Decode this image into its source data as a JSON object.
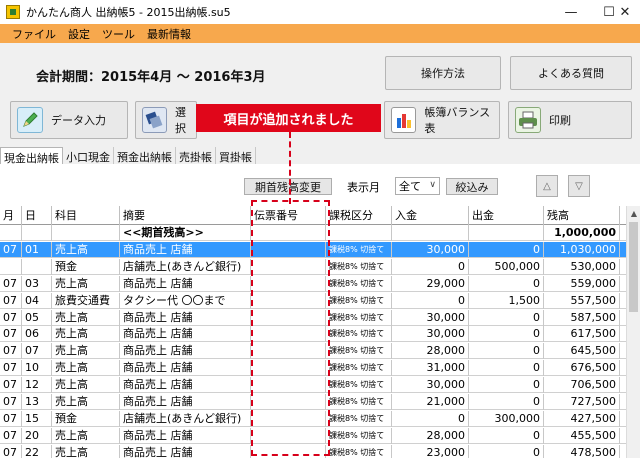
{
  "window": {
    "title": "かんたん商人 出納帳5 - 2015出納帳.su5",
    "minimize": "—",
    "maximize": "☐",
    "close": "✕"
  },
  "menu": [
    "ファイル",
    "設定",
    "ツール",
    "最新情報"
  ],
  "header": {
    "period": "会計期間：2015年4月 〜 2016年3月",
    "buttons": {
      "manual": "操作方法",
      "faq": "よくある質問",
      "data_entry": "データ入力",
      "select": "選択",
      "balance": "帳簿バランス表",
      "print": "印刷"
    }
  },
  "callout": "項目が追加されました",
  "tabs": [
    "現金出納帳",
    "小口現金",
    "預金出納帳",
    "売掛帳",
    "買掛帳"
  ],
  "filter": {
    "opening_balance_btn": "期首残高変更",
    "month_label": "表示月",
    "month_value": "全て",
    "filter_btn": "絞込み",
    "up": "△",
    "down": "▽"
  },
  "table": {
    "headers": [
      "月",
      "日",
      "科目",
      "摘要",
      "伝票番号",
      "課税区分",
      "入金",
      "出金",
      "残高"
    ],
    "rows": [
      {
        "m": "",
        "d": "",
        "kamoku": "",
        "tekiyo": "<<期首残高>>",
        "den": "",
        "tax": "",
        "in": "",
        "out": "",
        "bal": "1,000,000",
        "bold": true
      },
      {
        "m": "07",
        "d": "01",
        "kamoku": "売上高",
        "tekiyo": "商品売上 店舗",
        "den": "",
        "tax": "課税8% 切捨て",
        "in": "30,000",
        "out": "0",
        "bal": "1,030,000",
        "selected": true
      },
      {
        "m": "",
        "d": "",
        "kamoku": "預金",
        "tekiyo": "店舗売上(あきんど銀行)",
        "den": "",
        "tax": "課税8% 切捨て",
        "in": "0",
        "out": "500,000",
        "bal": "530,000"
      },
      {
        "m": "07",
        "d": "03",
        "kamoku": "売上高",
        "tekiyo": "商品売上 店舗",
        "den": "",
        "tax": "課税8% 切捨て",
        "in": "29,000",
        "out": "0",
        "bal": "559,000"
      },
      {
        "m": "07",
        "d": "04",
        "kamoku": "旅費交通費",
        "tekiyo": "タクシー代 〇〇まで",
        "den": "",
        "tax": "課税8% 切捨て",
        "in": "0",
        "out": "1,500",
        "bal": "557,500"
      },
      {
        "m": "07",
        "d": "05",
        "kamoku": "売上高",
        "tekiyo": "商品売上 店舗",
        "den": "",
        "tax": "課税8% 切捨て",
        "in": "30,000",
        "out": "0",
        "bal": "587,500"
      },
      {
        "m": "07",
        "d": "06",
        "kamoku": "売上高",
        "tekiyo": "商品売上 店舗",
        "den": "",
        "tax": "課税8% 切捨て",
        "in": "30,000",
        "out": "0",
        "bal": "617,500"
      },
      {
        "m": "07",
        "d": "07",
        "kamoku": "売上高",
        "tekiyo": "商品売上 店舗",
        "den": "",
        "tax": "課税8% 切捨て",
        "in": "28,000",
        "out": "0",
        "bal": "645,500"
      },
      {
        "m": "07",
        "d": "10",
        "kamoku": "売上高",
        "tekiyo": "商品売上 店舗",
        "den": "",
        "tax": "課税8% 切捨て",
        "in": "31,000",
        "out": "0",
        "bal": "676,500"
      },
      {
        "m": "07",
        "d": "12",
        "kamoku": "売上高",
        "tekiyo": "商品売上 店舗",
        "den": "",
        "tax": "課税8% 切捨て",
        "in": "30,000",
        "out": "0",
        "bal": "706,500"
      },
      {
        "m": "07",
        "d": "13",
        "kamoku": "売上高",
        "tekiyo": "商品売上 店舗",
        "den": "",
        "tax": "課税8% 切捨て",
        "in": "21,000",
        "out": "0",
        "bal": "727,500"
      },
      {
        "m": "07",
        "d": "15",
        "kamoku": "預金",
        "tekiyo": "店舗売上(あきんど銀行)",
        "den": "",
        "tax": "課税8% 切捨て",
        "in": "0",
        "out": "300,000",
        "bal": "427,500"
      },
      {
        "m": "07",
        "d": "20",
        "kamoku": "売上高",
        "tekiyo": "商品売上 店舗",
        "den": "",
        "tax": "課税8% 切捨て",
        "in": "28,000",
        "out": "0",
        "bal": "455,500"
      },
      {
        "m": "07",
        "d": "22",
        "kamoku": "売上高",
        "tekiyo": "商品売上 店舗",
        "den": "",
        "tax": "課税8% 切捨て",
        "in": "23,000",
        "out": "0",
        "bal": "478,500"
      }
    ]
  }
}
